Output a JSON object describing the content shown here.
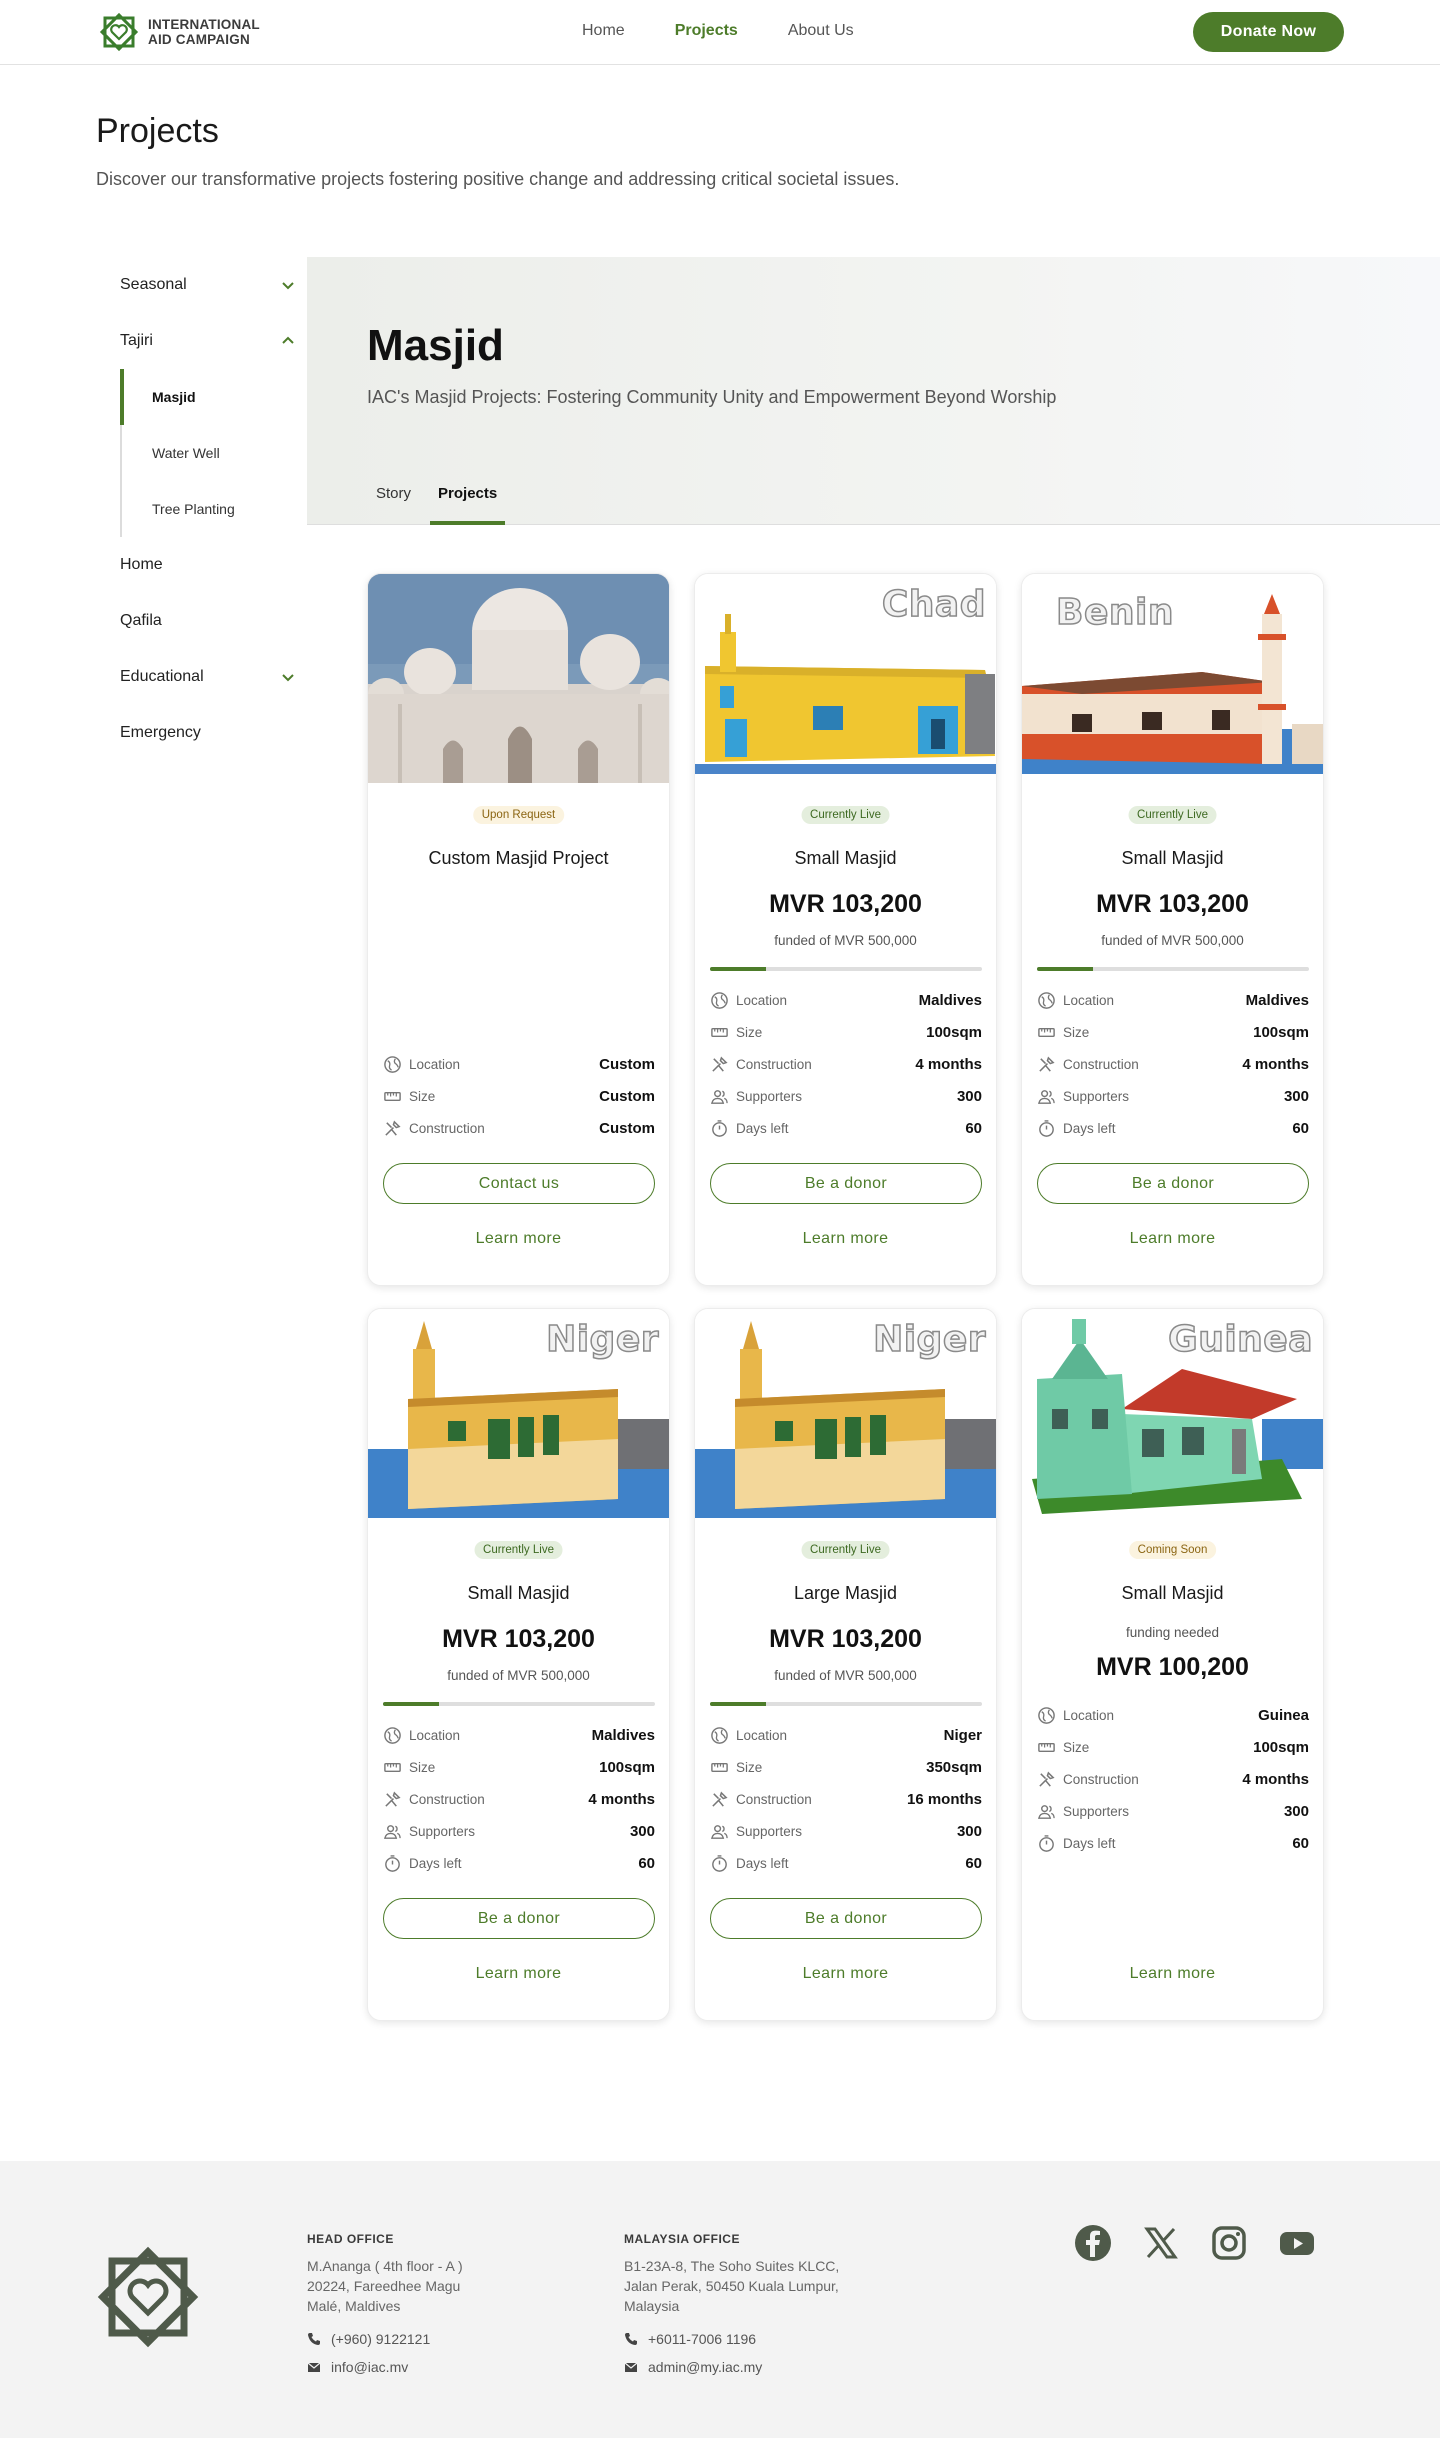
{
  "header": {
    "logo_line1": "INTERNATIONAL",
    "logo_line2": "AID CAMPAIGN",
    "nav": [
      "Home",
      "Projects",
      "About Us"
    ],
    "nav_active": "Projects",
    "donate_label": "Donate Now"
  },
  "page": {
    "title": "Projects",
    "subtitle": "Discover our transformative projects fostering positive change and addressing critical societal issues."
  },
  "sidebar": {
    "items": [
      {
        "label": "Seasonal",
        "expandable": true,
        "expanded": false
      },
      {
        "label": "Tajiri",
        "expandable": true,
        "expanded": true
      },
      {
        "label": "Home"
      },
      {
        "label": "Qafila"
      },
      {
        "label": "Educational",
        "expandable": true,
        "expanded": false
      },
      {
        "label": "Emergency"
      }
    ],
    "sub_items": [
      "Masjid",
      "Water Well",
      "Tree Planting"
    ],
    "active_sub": "Masjid"
  },
  "hero": {
    "title": "Masjid",
    "subtitle": "IAC's Masjid Projects: Fostering Community Unity and Empowerment Beyond Worship",
    "tabs": [
      "Story",
      "Projects"
    ],
    "active_tab": "Projects"
  },
  "labels": {
    "location": "Location",
    "size": "Size",
    "construction": "Construction",
    "supporters": "Supporters",
    "days_left": "Days left"
  },
  "cards": [
    {
      "country_label": "",
      "status": "Upon Request",
      "title": "Custom Masjid Project",
      "location": "Custom",
      "size": "Custom",
      "construction": "Custom",
      "cta": "Contact us",
      "learn": "Learn more"
    },
    {
      "country_label": "Chad",
      "status": "Currently Live",
      "title": "Small Masjid",
      "amount": "MVR 103,200",
      "funded": "funded of MVR 500,000",
      "progress": 0.206,
      "location": "Maldives",
      "size": "100sqm",
      "construction": "4 months",
      "supporters": "300",
      "days_left": "60",
      "cta": "Be a donor",
      "learn": "Learn more"
    },
    {
      "country_label": "Benin",
      "status": "Currently Live",
      "title": "Small Masjid",
      "amount": "MVR 103,200",
      "funded": "funded of MVR 500,000",
      "progress": 0.206,
      "location": "Maldives",
      "size": "100sqm",
      "construction": "4 months",
      "supporters": "300",
      "days_left": "60",
      "cta": "Be a donor",
      "learn": "Learn more"
    },
    {
      "country_label": "Niger",
      "status": "Currently Live",
      "title": "Small Masjid",
      "amount": "MVR 103,200",
      "funded": "funded of MVR 500,000",
      "progress": 0.206,
      "location": "Maldives",
      "size": "100sqm",
      "construction": "4 months",
      "supporters": "300",
      "days_left": "60",
      "cta": "Be a donor",
      "learn": "Learn more"
    },
    {
      "country_label": "Niger",
      "status": "Currently Live",
      "title": "Large Masjid",
      "amount": "MVR 103,200",
      "funded": "funded of MVR 500,000",
      "progress": 0.206,
      "location": "Niger",
      "size": "350sqm",
      "construction": "16 months",
      "supporters": "300",
      "days_left": "60",
      "cta": "Be a donor",
      "learn": "Learn more"
    },
    {
      "country_label": "Guinea",
      "status": "Coming Soon",
      "title": "Small Masjid",
      "funding_needed": "funding needed",
      "amount": "MVR 100,200",
      "location": "Guinea",
      "size": "100sqm",
      "construction": "4 months",
      "supporters": "300",
      "days_left": "60",
      "learn": "Learn more"
    }
  ],
  "footer": {
    "head_office": {
      "title": "HEAD OFFICE",
      "address": [
        "M.Ananga ( 4th floor - A )",
        "20224, Fareedhee Magu",
        "Malé, Maldives"
      ],
      "phone": "(+960) 9122121",
      "email": "info@iac.mv"
    },
    "malaysia_office": {
      "title": "MALAYSIA OFFICE",
      "address": [
        "B1-23A-8, The Soho Suites KLCC,",
        "Jalan Perak, 50450 Kuala Lumpur,",
        "Malaysia"
      ],
      "phone": "+6011-7006 1196",
      "email": "admin@my.iac.my"
    },
    "social_icons": [
      "facebook-icon",
      "x-icon",
      "instagram-icon",
      "youtube-icon"
    ]
  },
  "colors": {
    "brand_green": "#4d7c2a",
    "live_badge_bg": "#e4eedd",
    "soon_badge_bg": "#fbf3df"
  }
}
